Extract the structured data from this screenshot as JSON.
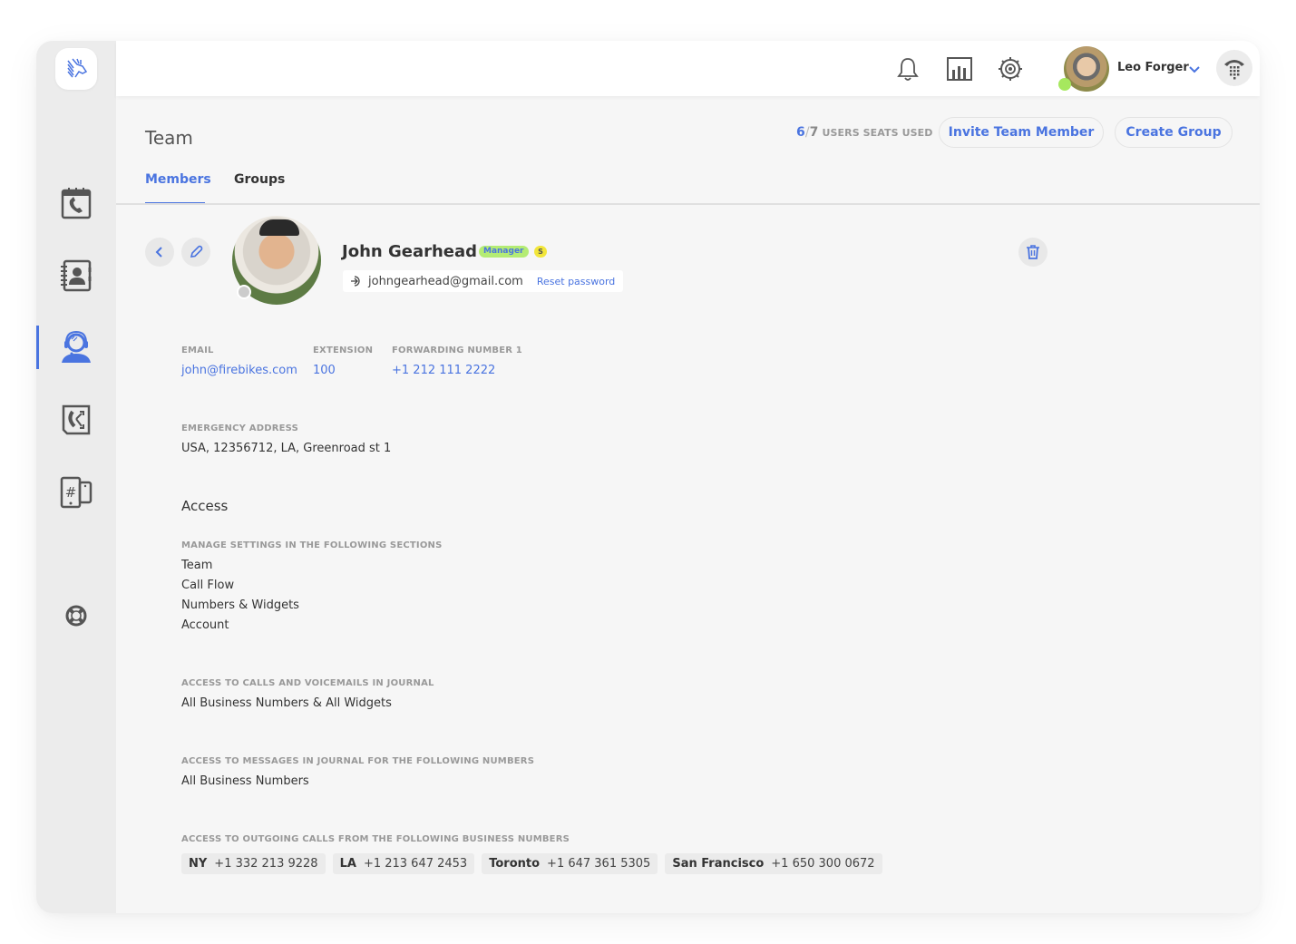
{
  "app": {
    "brand_color": "#4a74e0",
    "sidebar": {
      "items": [
        {
          "name": "call-journal",
          "icon": "calendar-phone-icon",
          "active": false
        },
        {
          "name": "contacts",
          "icon": "contact-book-icon",
          "active": false
        },
        {
          "name": "team",
          "icon": "headset-agent-icon",
          "active": true
        },
        {
          "name": "call-flow",
          "icon": "call-flow-icon",
          "active": false
        },
        {
          "name": "numbers-widgets",
          "icon": "hash-devices-icon",
          "active": false
        },
        {
          "name": "support",
          "icon": "lifebuoy-icon",
          "active": false
        }
      ]
    },
    "topbar": {
      "icons": [
        "bell-icon",
        "bar-chart-icon",
        "gear-icon"
      ],
      "user": {
        "name": "Leo Forger",
        "status_color": "#a6e85e"
      },
      "dialer_icon": "dialpad-phone-icon"
    }
  },
  "page": {
    "title": "Team",
    "seats": {
      "used": "6",
      "separator": "/",
      "total": "7",
      "label": "USERS SEATS USED"
    },
    "buttons": {
      "invite": "Invite Team Member",
      "create_group": "Create Group"
    },
    "tabs": [
      {
        "label": "Members",
        "active": true
      },
      {
        "label": "Groups",
        "active": false
      }
    ]
  },
  "member": {
    "name": "John Gearhead",
    "badges": {
      "role": "Manager",
      "tier": "S"
    },
    "login_email": "johngearhead@gmail.com",
    "reset_password": "Reset password",
    "fields": {
      "email": {
        "label": "EMAIL",
        "value": "john@firebikes.com"
      },
      "extension": {
        "label": "EXTENSION",
        "value": "100"
      },
      "forwarding": {
        "label": "FORWARDING NUMBER 1",
        "value": "+1 212 111 2222"
      },
      "emergency": {
        "label": "EMERGENCY ADDRESS",
        "value": "USA, 12356712, LA, Greenroad st 1"
      }
    },
    "access": {
      "title": "Access",
      "manage": {
        "label": "MANAGE SETTINGS IN THE FOLLOWING SECTIONS",
        "items": [
          "Team",
          "Call Flow",
          "Numbers & Widgets",
          "Account"
        ]
      },
      "calls_journal": {
        "label": "ACCESS TO CALLS AND VOICEMAILS IN JOURNAL",
        "value": "All Business Numbers & All Widgets"
      },
      "messages_journal": {
        "label": "ACCESS TO MESSAGES IN JOURNAL FOR THE FOLLOWING NUMBERS",
        "value": "All Business Numbers"
      },
      "outgoing": {
        "label": "ACCESS TO OUTGOING CALLS FROM THE FOLLOWING BUSINESS NUMBERS",
        "numbers": [
          {
            "name": "NY",
            "number": "+1 332 213 9228"
          },
          {
            "name": "LA",
            "number": "+1 213 647 2453"
          },
          {
            "name": "Toronto",
            "number": "+1 647 361 5305"
          },
          {
            "name": "San Francisco",
            "number": "+1 650 300 0672"
          }
        ]
      }
    }
  }
}
